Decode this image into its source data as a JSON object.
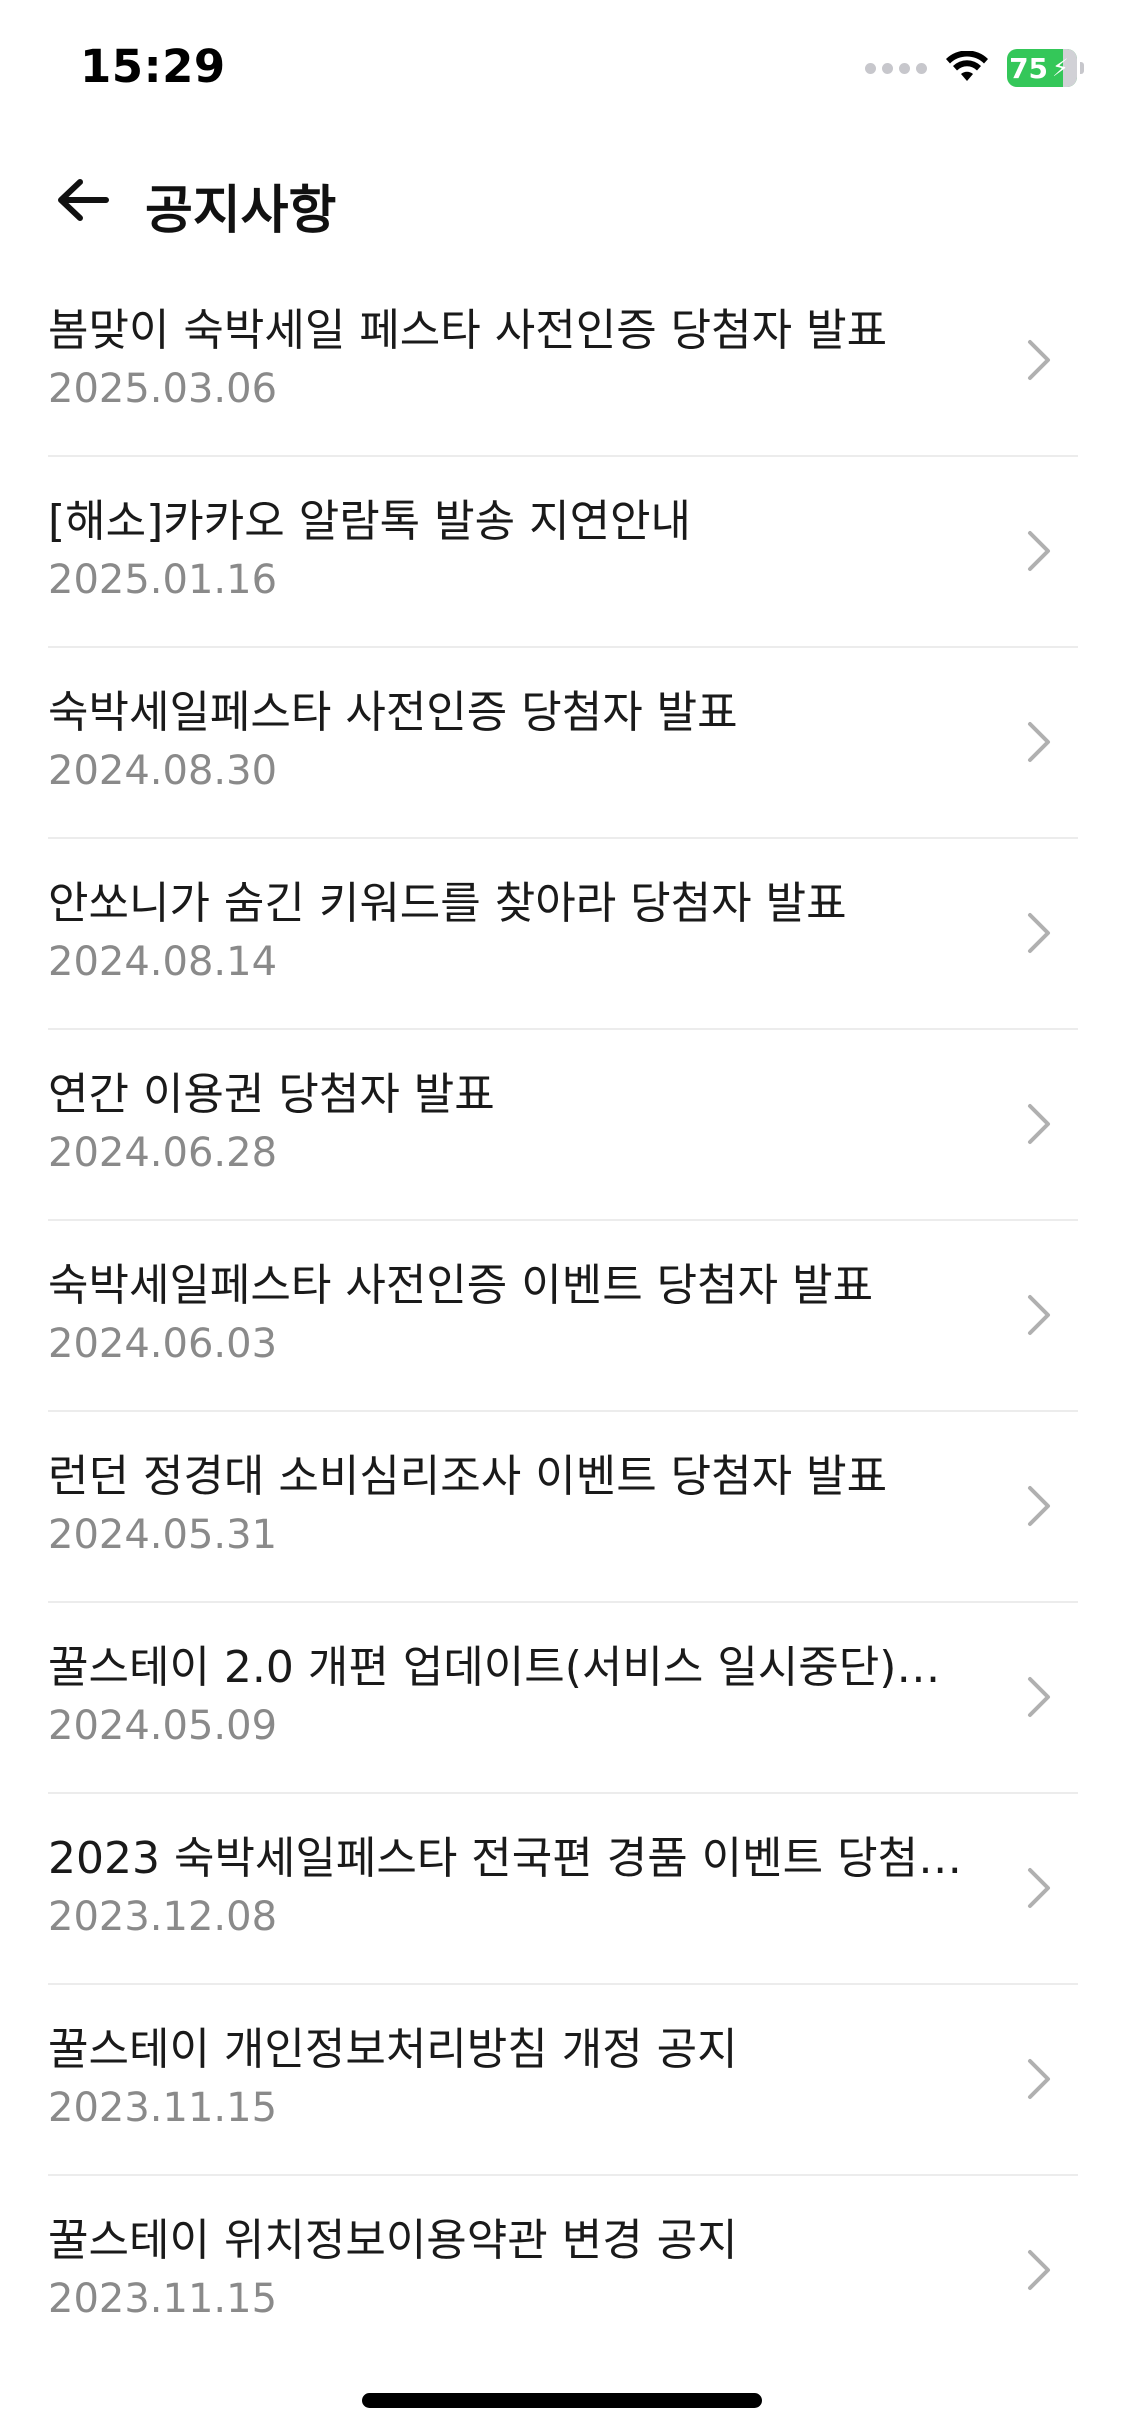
{
  "status_bar": {
    "time": "15:29",
    "battery_level": "75",
    "battery_charging": true,
    "icons": [
      "signal-icon",
      "wifi-icon",
      "battery-icon",
      "bolt-icon"
    ]
  },
  "header": {
    "back_icon": "arrow-left-icon",
    "title": "공지사항"
  },
  "notices": [
    {
      "title": "봄맞이 숙박세일 페스타 사전인증 당첨자 발표",
      "date": "2025.03.06"
    },
    {
      "title": "[해소]카카오 알람톡 발송 지연안내",
      "date": "2025.01.16"
    },
    {
      "title": "숙박세일페스타 사전인증 당첨자 발표",
      "date": "2024.08.30"
    },
    {
      "title": "안쏘니가 숨긴 키워드를 찾아라 당첨자 발표",
      "date": "2024.08.14"
    },
    {
      "title": "연간 이용권 당첨자 발표",
      "date": "2024.06.28"
    },
    {
      "title": "숙박세일페스타 사전인증 이벤트 당첨자 발표",
      "date": "2024.06.03"
    },
    {
      "title": "런던 정경대 소비심리조사 이벤트 당첨자 발표",
      "date": "2024.05.31"
    },
    {
      "title": "꿀스테이 2.0 개편 업데이트(서비스 일시중단)…",
      "date": "2024.05.09"
    },
    {
      "title": "2023 숙박세일페스타 전국편 경품 이벤트 당첨…",
      "date": "2023.12.08"
    },
    {
      "title": "꿀스테이 개인정보처리방침 개정 공지",
      "date": "2023.11.15"
    },
    {
      "title": "꿀스테이 위치정보이용약관 변경 공지",
      "date": "2023.11.15"
    }
  ],
  "colors": {
    "battery": "#34c759",
    "date_text": "#8a8a8a",
    "divider": "#ececec",
    "chevron": "#b0b0b0"
  }
}
